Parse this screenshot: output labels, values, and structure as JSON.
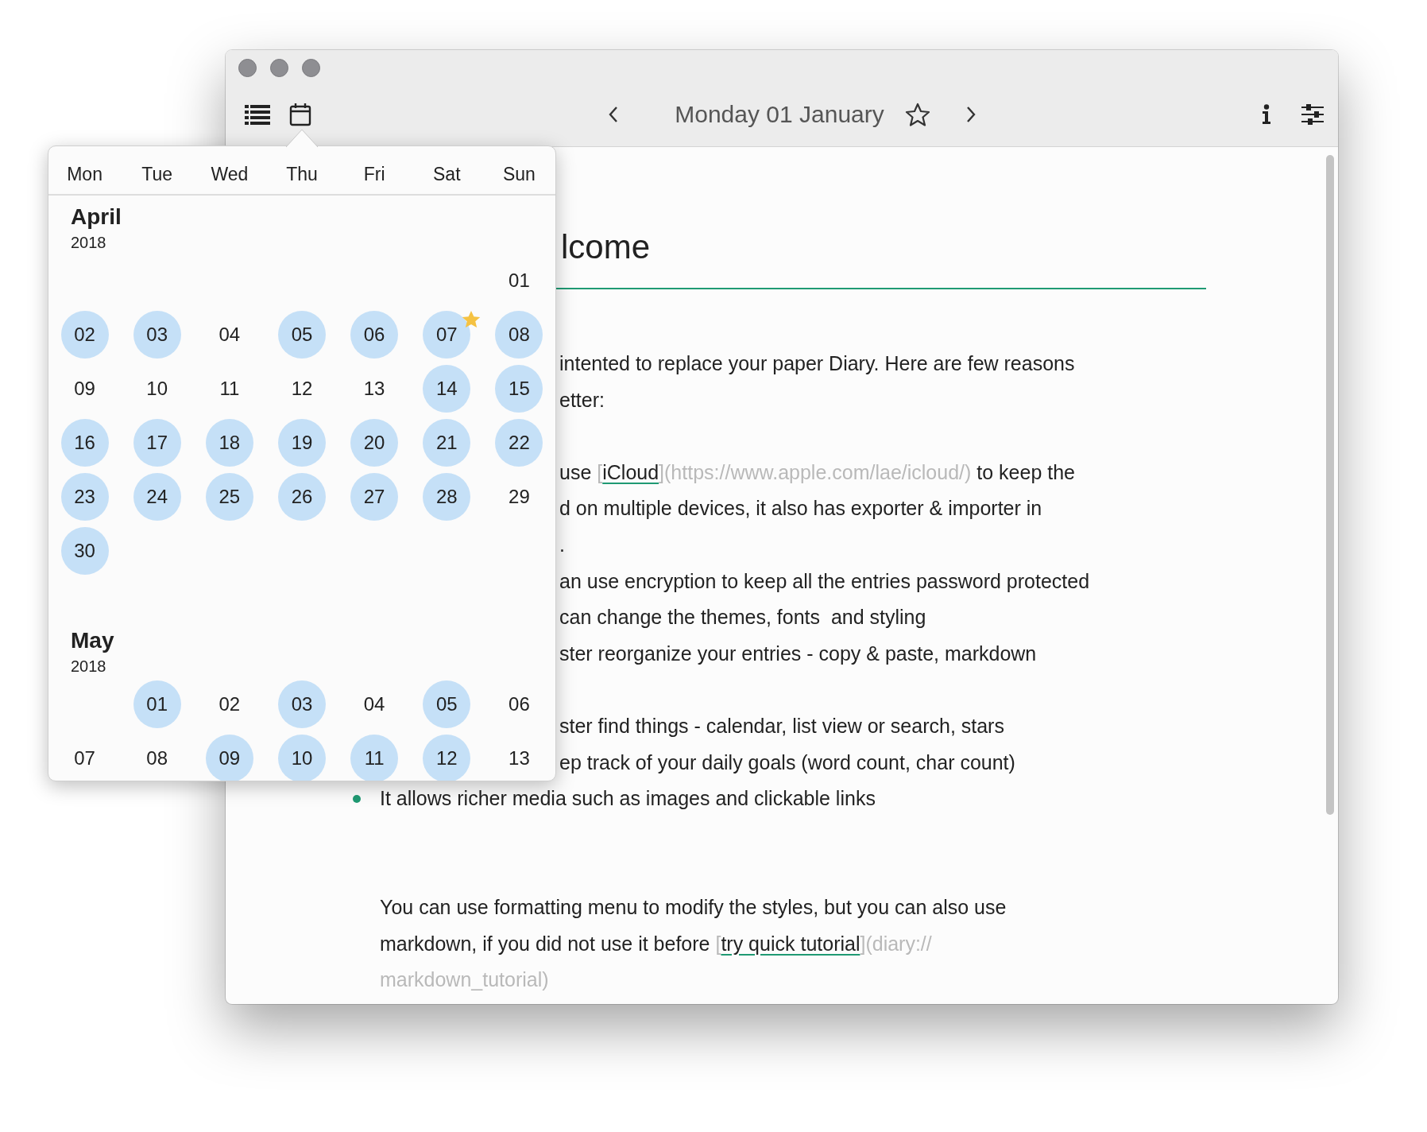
{
  "window": {
    "title_date": "Monday 01 January",
    "starred": false
  },
  "calendar": {
    "weekdays": [
      "Mon",
      "Tue",
      "Wed",
      "Thu",
      "Fri",
      "Sat",
      "Sun"
    ],
    "months": [
      {
        "name": "April",
        "year": "2018",
        "weeks": [
          {
            "kind": "padded",
            "days": [
              {
                "day": "01",
                "has_entry": false,
                "starred": false
              }
            ]
          },
          {
            "kind": "plain",
            "days": [
              {
                "day": "02",
                "has_entry": true,
                "starred": false
              },
              {
                "day": "03",
                "has_entry": true,
                "starred": false
              },
              {
                "day": "04",
                "has_entry": false,
                "starred": false
              },
              {
                "day": "05",
                "has_entry": true,
                "starred": false
              },
              {
                "day": "06",
                "has_entry": true,
                "starred": false
              },
              {
                "day": "07",
                "has_entry": true,
                "starred": true
              },
              {
                "day": "08",
                "has_entry": true,
                "starred": false
              }
            ]
          },
          {
            "kind": "plain",
            "days": [
              {
                "day": "09",
                "has_entry": false,
                "starred": false
              },
              {
                "day": "10",
                "has_entry": false,
                "starred": false
              },
              {
                "day": "11",
                "has_entry": false,
                "starred": false
              },
              {
                "day": "12",
                "has_entry": false,
                "starred": false
              },
              {
                "day": "13",
                "has_entry": false,
                "starred": false
              },
              {
                "day": "14",
                "has_entry": true,
                "starred": false
              },
              {
                "day": "15",
                "has_entry": true,
                "starred": false
              }
            ]
          },
          {
            "kind": "plain",
            "days": [
              {
                "day": "16",
                "has_entry": true,
                "starred": false
              },
              {
                "day": "17",
                "has_entry": true,
                "starred": false
              },
              {
                "day": "18",
                "has_entry": true,
                "starred": false
              },
              {
                "day": "19",
                "has_entry": true,
                "starred": false
              },
              {
                "day": "20",
                "has_entry": true,
                "starred": false
              },
              {
                "day": "21",
                "has_entry": true,
                "starred": false
              },
              {
                "day": "22",
                "has_entry": true,
                "starred": false
              }
            ]
          },
          {
            "kind": "plain",
            "days": [
              {
                "day": "23",
                "has_entry": true,
                "starred": false
              },
              {
                "day": "24",
                "has_entry": true,
                "starred": false
              },
              {
                "day": "25",
                "has_entry": true,
                "starred": false
              },
              {
                "day": "26",
                "has_entry": true,
                "starred": false
              },
              {
                "day": "27",
                "has_entry": true,
                "starred": false
              },
              {
                "day": "28",
                "has_entry": true,
                "starred": false
              },
              {
                "day": "29",
                "has_entry": false,
                "starred": false
              }
            ]
          },
          {
            "kind": "plain",
            "days": [
              {
                "day": "30",
                "has_entry": true,
                "starred": false
              }
            ]
          }
        ]
      },
      {
        "name": "May",
        "year": "2018",
        "weeks": [
          {
            "kind": "padded",
            "days": [
              {
                "day": "01",
                "has_entry": true,
                "starred": false
              },
              {
                "day": "02",
                "has_entry": false,
                "starred": false
              },
              {
                "day": "03",
                "has_entry": true,
                "starred": false
              },
              {
                "day": "04",
                "has_entry": false,
                "starred": false
              },
              {
                "day": "05",
                "has_entry": true,
                "starred": false
              },
              {
                "day": "06",
                "has_entry": false,
                "starred": false
              }
            ]
          },
          {
            "kind": "plain",
            "days": [
              {
                "day": "07",
                "has_entry": false,
                "starred": false
              },
              {
                "day": "08",
                "has_entry": false,
                "starred": false
              },
              {
                "day": "09",
                "has_entry": true,
                "starred": false
              },
              {
                "day": "10",
                "has_entry": true,
                "starred": false
              },
              {
                "day": "11",
                "has_entry": true,
                "starred": false
              },
              {
                "day": "12",
                "has_entry": true,
                "starred": false
              },
              {
                "day": "13",
                "has_entry": false,
                "starred": false
              }
            ]
          }
        ]
      }
    ]
  },
  "editor": {
    "heading": "lcome",
    "lines": [
      {
        "kind": "clipped",
        "parts": [
          {
            "kind": "text",
            "text": "intented to replace your paper Diary. Here are few reasons"
          }
        ]
      },
      {
        "kind": "clipped",
        "parts": [
          {
            "kind": "text",
            "text": "etter:"
          }
        ]
      },
      {
        "kind": "spacer"
      },
      {
        "kind": "clipped",
        "parts": [
          {
            "kind": "text",
            "text": "use "
          },
          {
            "kind": "markup",
            "text": "["
          },
          {
            "kind": "link",
            "text": "iCloud"
          },
          {
            "kind": "markup",
            "text": "](https://www.apple.com/lae/icloud/)"
          },
          {
            "kind": "text",
            "text": " to keep the"
          }
        ]
      },
      {
        "kind": "clipped",
        "parts": [
          {
            "kind": "text",
            "text": "d on multiple devices, it also has exporter & importer in"
          }
        ]
      },
      {
        "kind": "clipped",
        "parts": [
          {
            "kind": "text",
            "text": "."
          }
        ]
      },
      {
        "kind": "clipped",
        "parts": [
          {
            "kind": "text",
            "text": "an use encryption to keep all the entries password protected"
          }
        ]
      },
      {
        "kind": "clipped",
        "parts": [
          {
            "kind": "text",
            "text": "can change the themes, fonts  and styling"
          }
        ]
      },
      {
        "kind": "clipped",
        "parts": [
          {
            "kind": "text",
            "text": "ster reorganize your entries - copy & paste, markdown"
          }
        ]
      },
      {
        "kind": "spacer"
      },
      {
        "kind": "clipped",
        "parts": [
          {
            "kind": "text",
            "text": "ster find things - calendar, list view or search, stars"
          }
        ]
      },
      {
        "kind": "clipped",
        "parts": [
          {
            "kind": "text",
            "text": "ep track of your daily goals (word count, char count)"
          }
        ]
      },
      {
        "kind": "bullet",
        "parts": [
          {
            "kind": "text",
            "text": "It allows richer media such as images and clickable links"
          }
        ]
      },
      {
        "kind": "spacer"
      },
      {
        "kind": "spacer"
      },
      {
        "kind": "paragraph",
        "rows": [
          [
            {
              "kind": "text",
              "text": "You can use formatting menu to modify the styles, but you can also use"
            }
          ],
          [
            {
              "kind": "text",
              "text": "markdown, if you did not use it before "
            },
            {
              "kind": "markup",
              "text": "["
            },
            {
              "kind": "link",
              "text": "try quick tutorial"
            },
            {
              "kind": "markup",
              "text": "](diary://"
            }
          ],
          [
            {
              "kind": "markup",
              "text": "markdown_tutorial)"
            }
          ]
        ]
      }
    ]
  }
}
